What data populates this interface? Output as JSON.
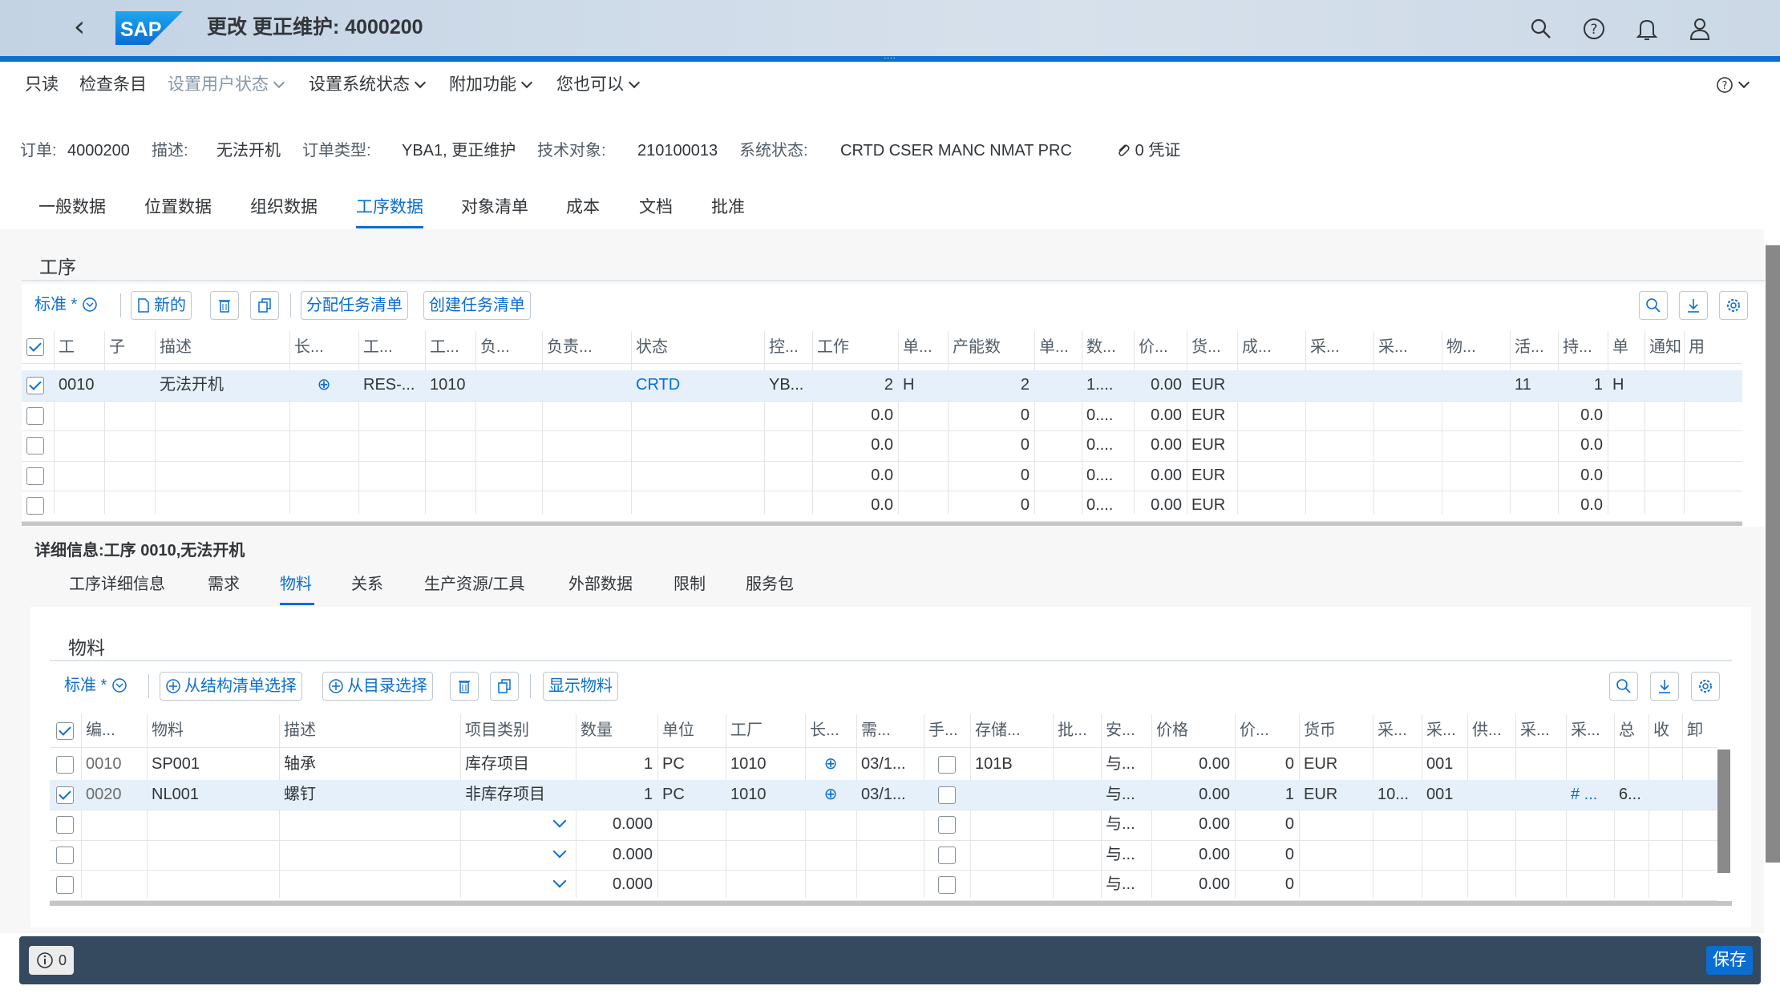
{
  "shell": {
    "title": "更改 更正维护: 4000200",
    "logo_text": "SAP"
  },
  "menu": {
    "items": [
      {
        "label": "只读",
        "dis": false
      },
      {
        "label": "检查条目",
        "dis": false
      },
      {
        "label": "设置用户状态",
        "dis": true
      },
      {
        "label": "设置系统状态",
        "dis": false
      },
      {
        "label": "附加功能",
        "dis": false
      },
      {
        "label": "您也可以",
        "dis": false
      }
    ]
  },
  "header": {
    "order_label": "订单:",
    "order": "4000200",
    "desc_label": "描述:",
    "desc": "无法开机",
    "type_label": "订单类型:",
    "type": "YBA1, 更正维护",
    "tech_label": "技术对象:",
    "tech": "210100013",
    "sys_label": "系统状态:",
    "sys": "CRTD CSER MANC NMAT PRC",
    "attach": "0 凭证"
  },
  "tabs": [
    "一般数据",
    "位置数据",
    "组织数据",
    "工序数据",
    "对象清单",
    "成本",
    "文档",
    "批准"
  ],
  "ops": {
    "title": "工序",
    "variant": "标准 *",
    "new": "新的",
    "assign": "分配任务清单",
    "create": "创建任务清单",
    "headers": [
      "工",
      "子",
      "描述",
      "长...",
      "工...",
      "工...",
      "负...",
      "负责...",
      "状态",
      "控...",
      "工作",
      "单...",
      "产能数",
      "单...",
      "数...",
      "价...",
      "货...",
      "成...",
      "采...",
      "采...",
      "物...",
      "活...",
      "持...",
      "单",
      "通知",
      "用"
    ],
    "rows": [
      [
        "0010",
        "",
        "无法开机",
        "⊕",
        "RES-...",
        "1010",
        "",
        "",
        "CRTD",
        "YB...",
        "2",
        "H",
        "2",
        "",
        "1....",
        "0.00",
        "EUR",
        "",
        "",
        "",
        "",
        "11",
        "1",
        "H",
        "",
        ""
      ],
      [
        "",
        "",
        "",
        "",
        "",
        "",
        "",
        "",
        "",
        "",
        "0.0",
        "",
        "0",
        "",
        "0....",
        "0.00",
        "EUR",
        "",
        "",
        "",
        "",
        "",
        "0.0",
        "",
        "",
        ""
      ],
      [
        "",
        "",
        "",
        "",
        "",
        "",
        "",
        "",
        "",
        "",
        "0.0",
        "",
        "0",
        "",
        "0....",
        "0.00",
        "EUR",
        "",
        "",
        "",
        "",
        "",
        "0.0",
        "",
        "",
        ""
      ],
      [
        "",
        "",
        "",
        "",
        "",
        "",
        "",
        "",
        "",
        "",
        "0.0",
        "",
        "0",
        "",
        "0....",
        "0.00",
        "EUR",
        "",
        "",
        "",
        "",
        "",
        "0.0",
        "",
        "",
        ""
      ],
      [
        "",
        "",
        "",
        "",
        "",
        "",
        "",
        "",
        "",
        "",
        "0.0",
        "",
        "0",
        "",
        "0....",
        "0.00",
        "EUR",
        "",
        "",
        "",
        "",
        "",
        "0.0",
        "",
        "",
        ""
      ]
    ]
  },
  "detail": {
    "title": "详细信息:工序 0010,无法开机",
    "tabs": [
      "工序详细信息",
      "需求",
      "物料",
      "关系",
      "生产资源/工具",
      "外部数据",
      "限制",
      "服务包"
    ]
  },
  "mat": {
    "title": "物料",
    "variant": "标准 *",
    "from_bom": "从结构清单选择",
    "from_cat": "从目录选择",
    "show": "显示物料",
    "headers": [
      "编...",
      "物料",
      "描述",
      "项目类别",
      "数量",
      "单位",
      "工厂",
      "长...",
      "需...",
      "手...",
      "存储...",
      "批...",
      "安...",
      "价格",
      "价...",
      "货币",
      "采...",
      "采...",
      "供...",
      "采...",
      "采...",
      "总",
      "收",
      "卸"
    ],
    "rows": [
      [
        "0010",
        "SP001",
        "轴承",
        "库存项目",
        "1",
        "PC",
        "1010",
        "⊕",
        "03/1...",
        "",
        "101B",
        "",
        "与...",
        "0.00",
        "0",
        "EUR",
        "",
        "001",
        "",
        "",
        "",
        "",
        "",
        ""
      ],
      [
        "0020",
        "NL001",
        "螺钉",
        "非库存项目",
        "1",
        "PC",
        "1010",
        "⊕",
        "03/1...",
        "",
        "",
        "",
        "与...",
        "0.00",
        "1",
        "EUR",
        "10...",
        "001",
        "",
        "",
        "# ...",
        "6...",
        "",
        ""
      ],
      [
        "",
        "",
        "",
        "",
        "0.000",
        "",
        "",
        "",
        "",
        "",
        "",
        "",
        "与...",
        "0.00",
        "0",
        "",
        "",
        "",
        "",
        "",
        "",
        "",
        "",
        ""
      ],
      [
        "",
        "",
        "",
        "",
        "0.000",
        "",
        "",
        "",
        "",
        "",
        "",
        "",
        "与...",
        "0.00",
        "0",
        "",
        "",
        "",
        "",
        "",
        "",
        "",
        "",
        ""
      ],
      [
        "",
        "",
        "",
        "",
        "0.000",
        "",
        "",
        "",
        "",
        "",
        "",
        "",
        "与...",
        "0.00",
        "0",
        "",
        "",
        "",
        "",
        "",
        "",
        "",
        "",
        ""
      ]
    ]
  },
  "footer": {
    "msg_count": "0",
    "save": "保存"
  }
}
